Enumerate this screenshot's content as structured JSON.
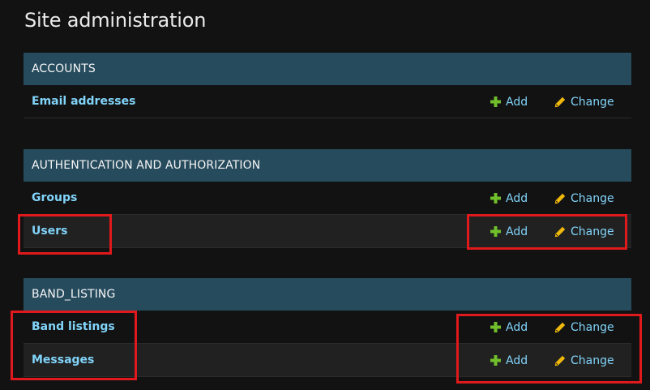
{
  "page": {
    "title": "Site administration"
  },
  "colors": {
    "background": "#121212",
    "module_header": "#264b5d",
    "link": "#81d4fa",
    "add_icon": "#70bf2b",
    "change_icon": "#efb80b",
    "highlight": "#e0191c"
  },
  "modules": [
    {
      "caption": "ACCOUNTS",
      "models": [
        {
          "name": "Email addresses",
          "add": "Add",
          "change": "Change"
        }
      ]
    },
    {
      "caption": "AUTHENTICATION AND AUTHORIZATION",
      "models": [
        {
          "name": "Groups",
          "add": "Add",
          "change": "Change"
        },
        {
          "name": "Users",
          "add": "Add",
          "change": "Change"
        }
      ]
    },
    {
      "caption": "BAND_LISTING",
      "models": [
        {
          "name": "Band listings",
          "add": "Add",
          "change": "Change"
        },
        {
          "name": "Messages",
          "add": "Add",
          "change": "Change"
        }
      ]
    }
  ],
  "icons": {
    "add": "plus-icon",
    "change": "pencil-icon"
  }
}
